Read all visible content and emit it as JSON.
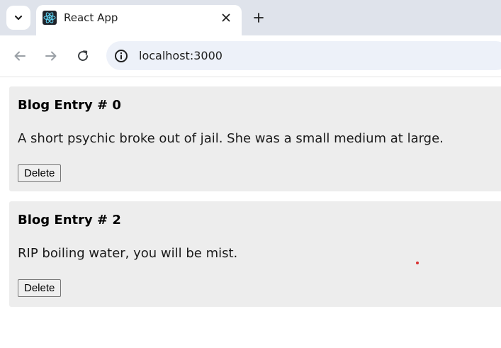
{
  "browser": {
    "tab": {
      "title": "React App"
    },
    "address": {
      "url": "localhost:3000"
    }
  },
  "posts": [
    {
      "title": "Blog Entry # 0",
      "body": "A short psychic broke out of jail. She was a small medium at large.",
      "delete_label": "Delete"
    },
    {
      "title": "Blog Entry # 2",
      "body": "RIP boiling water, you will be mist.",
      "delete_label": "Delete"
    }
  ],
  "colors": {
    "tabstrip": "#dfe3eb",
    "card": "#ededed",
    "omnibox": "#edf1f9",
    "react_logo": "#61dafb",
    "cursor": "#d93030"
  },
  "icons": [
    "chevron-down-icon",
    "react-logo-icon",
    "close-icon",
    "plus-icon",
    "back-arrow-icon",
    "forward-arrow-icon",
    "reload-icon",
    "info-icon"
  ]
}
